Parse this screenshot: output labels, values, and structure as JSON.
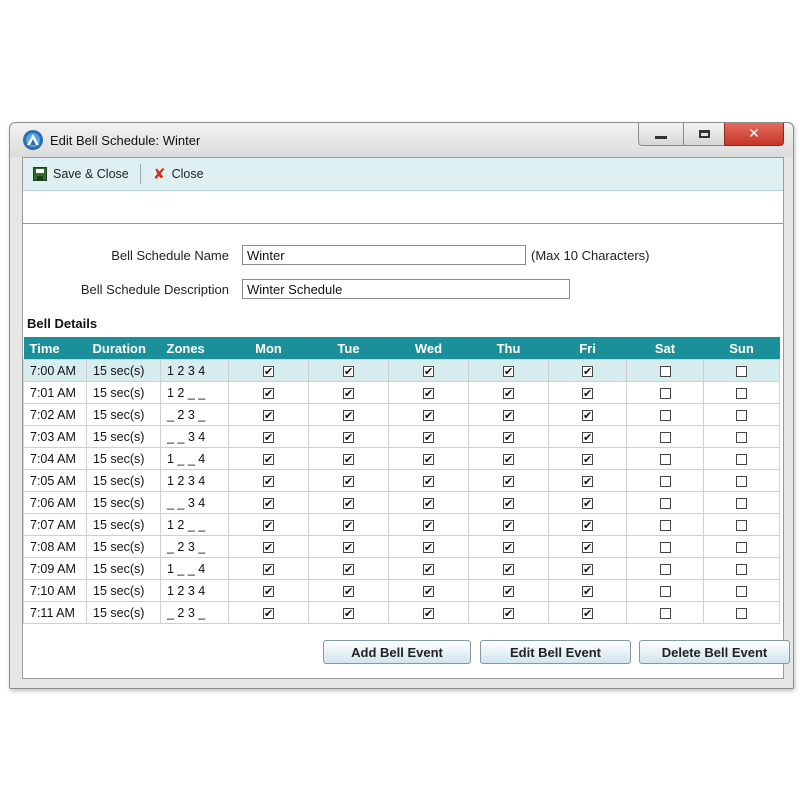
{
  "window": {
    "title": "Edit Bell Schedule: Winter",
    "close_glyph": "✕"
  },
  "toolbar": {
    "save_label": "Save & Close",
    "close_label": "Close",
    "close_glyph": "✘"
  },
  "form": {
    "name_label": "Bell Schedule Name",
    "name_value": "Winter",
    "name_hint": "(Max 10 Characters)",
    "desc_label": "Bell Schedule Description",
    "desc_value": "Winter Schedule"
  },
  "details": {
    "section_title": "Bell Details",
    "columns": [
      "Time",
      "Duration",
      "Zones",
      "Mon",
      "Tue",
      "Wed",
      "Thu",
      "Fri",
      "Sat",
      "Sun"
    ],
    "rows": [
      {
        "time": "7:00 AM",
        "duration": "15 sec(s)",
        "zones": "1 2 3 4",
        "days": [
          true,
          true,
          true,
          true,
          true,
          false,
          false
        ]
      },
      {
        "time": "7:01 AM",
        "duration": "15 sec(s)",
        "zones": "1 2 _ _",
        "days": [
          true,
          true,
          true,
          true,
          true,
          false,
          false
        ]
      },
      {
        "time": "7:02 AM",
        "duration": "15 sec(s)",
        "zones": "_ 2 3 _",
        "days": [
          true,
          true,
          true,
          true,
          true,
          false,
          false
        ]
      },
      {
        "time": "7:03 AM",
        "duration": "15 sec(s)",
        "zones": "_ _ 3 4",
        "days": [
          true,
          true,
          true,
          true,
          true,
          false,
          false
        ]
      },
      {
        "time": "7:04 AM",
        "duration": "15 sec(s)",
        "zones": "1 _ _ 4",
        "days": [
          true,
          true,
          true,
          true,
          true,
          false,
          false
        ]
      },
      {
        "time": "7:05 AM",
        "duration": "15 sec(s)",
        "zones": "1 2 3 4",
        "days": [
          true,
          true,
          true,
          true,
          true,
          false,
          false
        ]
      },
      {
        "time": "7:06 AM",
        "duration": "15 sec(s)",
        "zones": "_ _ 3 4",
        "days": [
          true,
          true,
          true,
          true,
          true,
          false,
          false
        ]
      },
      {
        "time": "7:07 AM",
        "duration": "15 sec(s)",
        "zones": "1 2 _ _",
        "days": [
          true,
          true,
          true,
          true,
          true,
          false,
          false
        ]
      },
      {
        "time": "7:08 AM",
        "duration": "15 sec(s)",
        "zones": "_ 2 3 _",
        "days": [
          true,
          true,
          true,
          true,
          true,
          false,
          false
        ]
      },
      {
        "time": "7:09 AM",
        "duration": "15 sec(s)",
        "zones": "1 _ _ 4",
        "days": [
          true,
          true,
          true,
          true,
          true,
          false,
          false
        ]
      },
      {
        "time": "7:10 AM",
        "duration": "15 sec(s)",
        "zones": "1 2 3 4",
        "days": [
          true,
          true,
          true,
          true,
          true,
          false,
          false
        ]
      },
      {
        "time": "7:11 AM",
        "duration": "15 sec(s)",
        "zones": "_ 2 3 _",
        "days": [
          true,
          true,
          true,
          true,
          true,
          false,
          false
        ]
      }
    ],
    "check_glyph": "✔"
  },
  "actions": {
    "add_label": "Add Bell Event",
    "edit_label": "Edit Bell Event",
    "delete_label": "Delete Bell Event"
  },
  "colors": {
    "header_bg": "#1b8f9a",
    "toolbar_bg": "#dff0f3",
    "selected_row_bg": "#d6ecef",
    "close_button": "#c3372a"
  },
  "icons": {
    "app": "app-logo-icon",
    "save": "floppy-disk-icon",
    "close": "red-x-icon",
    "minimize": "minimize-icon",
    "maximize": "maximize-icon",
    "window_close": "close-icon"
  }
}
